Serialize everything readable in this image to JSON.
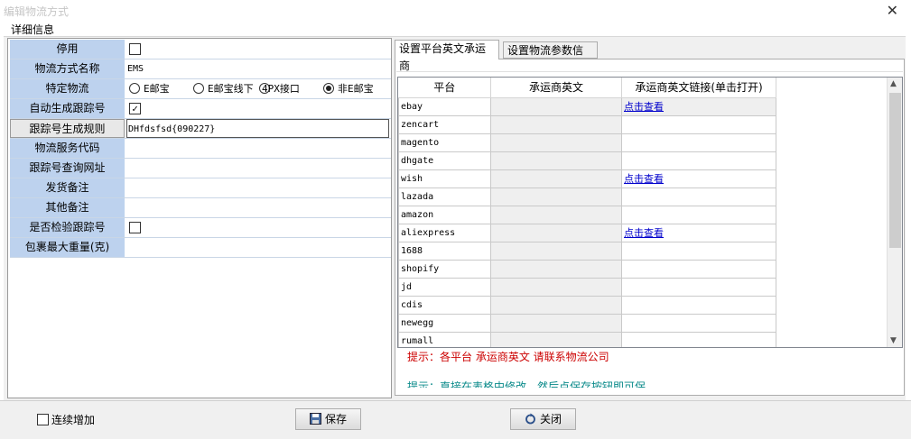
{
  "window": {
    "title": "编辑物流方式",
    "close_glyph": "✕"
  },
  "menu": {
    "detail": "详细信息"
  },
  "form": {
    "disabled_label": "停用",
    "name_label": "物流方式名称",
    "name_value": "EMS",
    "special_label": "特定物流",
    "special_options": [
      "E邮宝",
      "E邮宝线下",
      "4PX接口",
      "非E邮宝"
    ],
    "special_selected": 3,
    "auto_track_label": "自动生成跟踪号",
    "track_rule_label": "跟踪号生成规则",
    "track_rule_value": "DHfdsfsd{090227}",
    "service_code_label": "物流服务代码",
    "query_url_label": "跟踪号查询网址",
    "ship_note_label": "发货备注",
    "other_note_label": "其他备注",
    "verify_label": "是否检验跟踪号",
    "max_weight_label": "包裹最大重量(克)"
  },
  "tabs": [
    {
      "label": "设置平台英文承运商",
      "active": true
    },
    {
      "label": "设置物流参数信息",
      "active": false
    }
  ],
  "grid": {
    "headers": [
      "平台",
      "承运商英文",
      "承运商英文链接(单击打开)"
    ],
    "rows": [
      {
        "platform": "ebay",
        "carrier": "",
        "link": "点击查看"
      },
      {
        "platform": "zencart",
        "carrier": "",
        "link": ""
      },
      {
        "platform": "magento",
        "carrier": "",
        "link": ""
      },
      {
        "platform": "dhgate",
        "carrier": "",
        "link": ""
      },
      {
        "platform": "wish",
        "carrier": "",
        "link": "点击查看"
      },
      {
        "platform": "lazada",
        "carrier": "",
        "link": ""
      },
      {
        "platform": "amazon",
        "carrier": "",
        "link": ""
      },
      {
        "platform": "aliexpress",
        "carrier": "",
        "link": "点击查看"
      },
      {
        "platform": "1688",
        "carrier": "",
        "link": ""
      },
      {
        "platform": "shopify",
        "carrier": "",
        "link": ""
      },
      {
        "platform": "jd",
        "carrier": "",
        "link": ""
      },
      {
        "platform": "cdis",
        "carrier": "",
        "link": ""
      },
      {
        "platform": "newegg",
        "carrier": "",
        "link": ""
      },
      {
        "platform": "rumall",
        "carrier": "",
        "link": ""
      }
    ]
  },
  "hints": {
    "hint1": "提示：各平台 承运商英文 请联系物流公司",
    "hint2": "提示：直接在表格中修改，然后点保存按钮即可保"
  },
  "footer": {
    "continue_add": "连续增加",
    "save": "保存",
    "close": "关闭"
  },
  "colors": {
    "label_bg": "#bdd2ee",
    "link": "#0000cc",
    "hint_red": "#cc0000",
    "hint_teal": "#0a8a8a"
  }
}
